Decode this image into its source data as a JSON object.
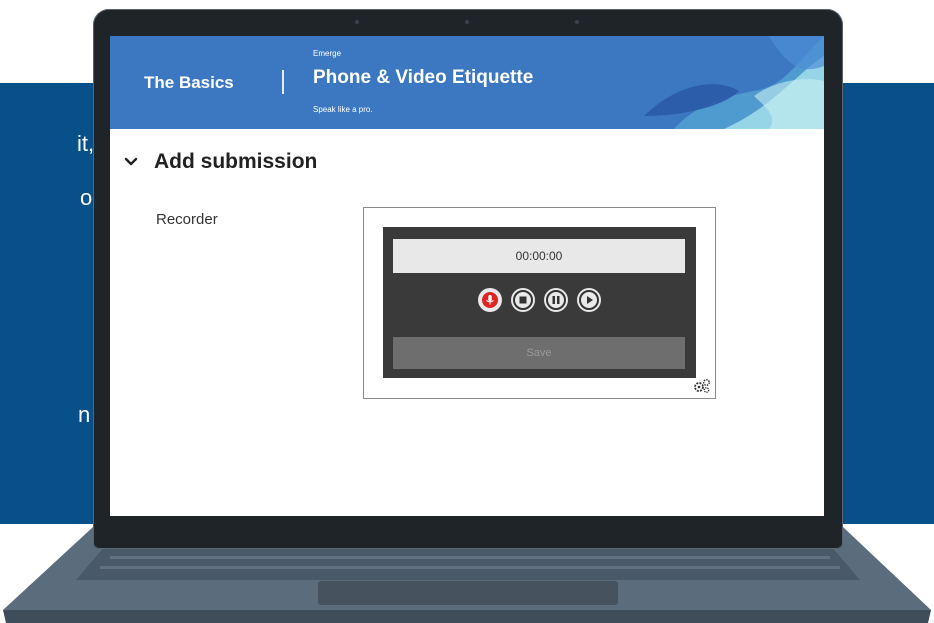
{
  "slide_fragments": [
    "it,",
    "o",
    "n"
  ],
  "screen": {
    "header": {
      "section": "The Basics",
      "brand": "Emerge",
      "course_title": "Phone & Video Etiquette",
      "tagline": "Speak like a pro."
    },
    "submission": {
      "heading": "Add submission",
      "recorder_label": "Recorder",
      "timer": "00:00:00",
      "save_label": "Save"
    }
  },
  "icons": [
    "chevron-down-icon",
    "microphone-icon",
    "stop-icon",
    "pause-icon",
    "play-icon",
    "settings-gears-icon"
  ],
  "colors": {
    "header_blue": "#3c78c2",
    "slide_blue": "#07508a",
    "record_red": "#e02525"
  }
}
